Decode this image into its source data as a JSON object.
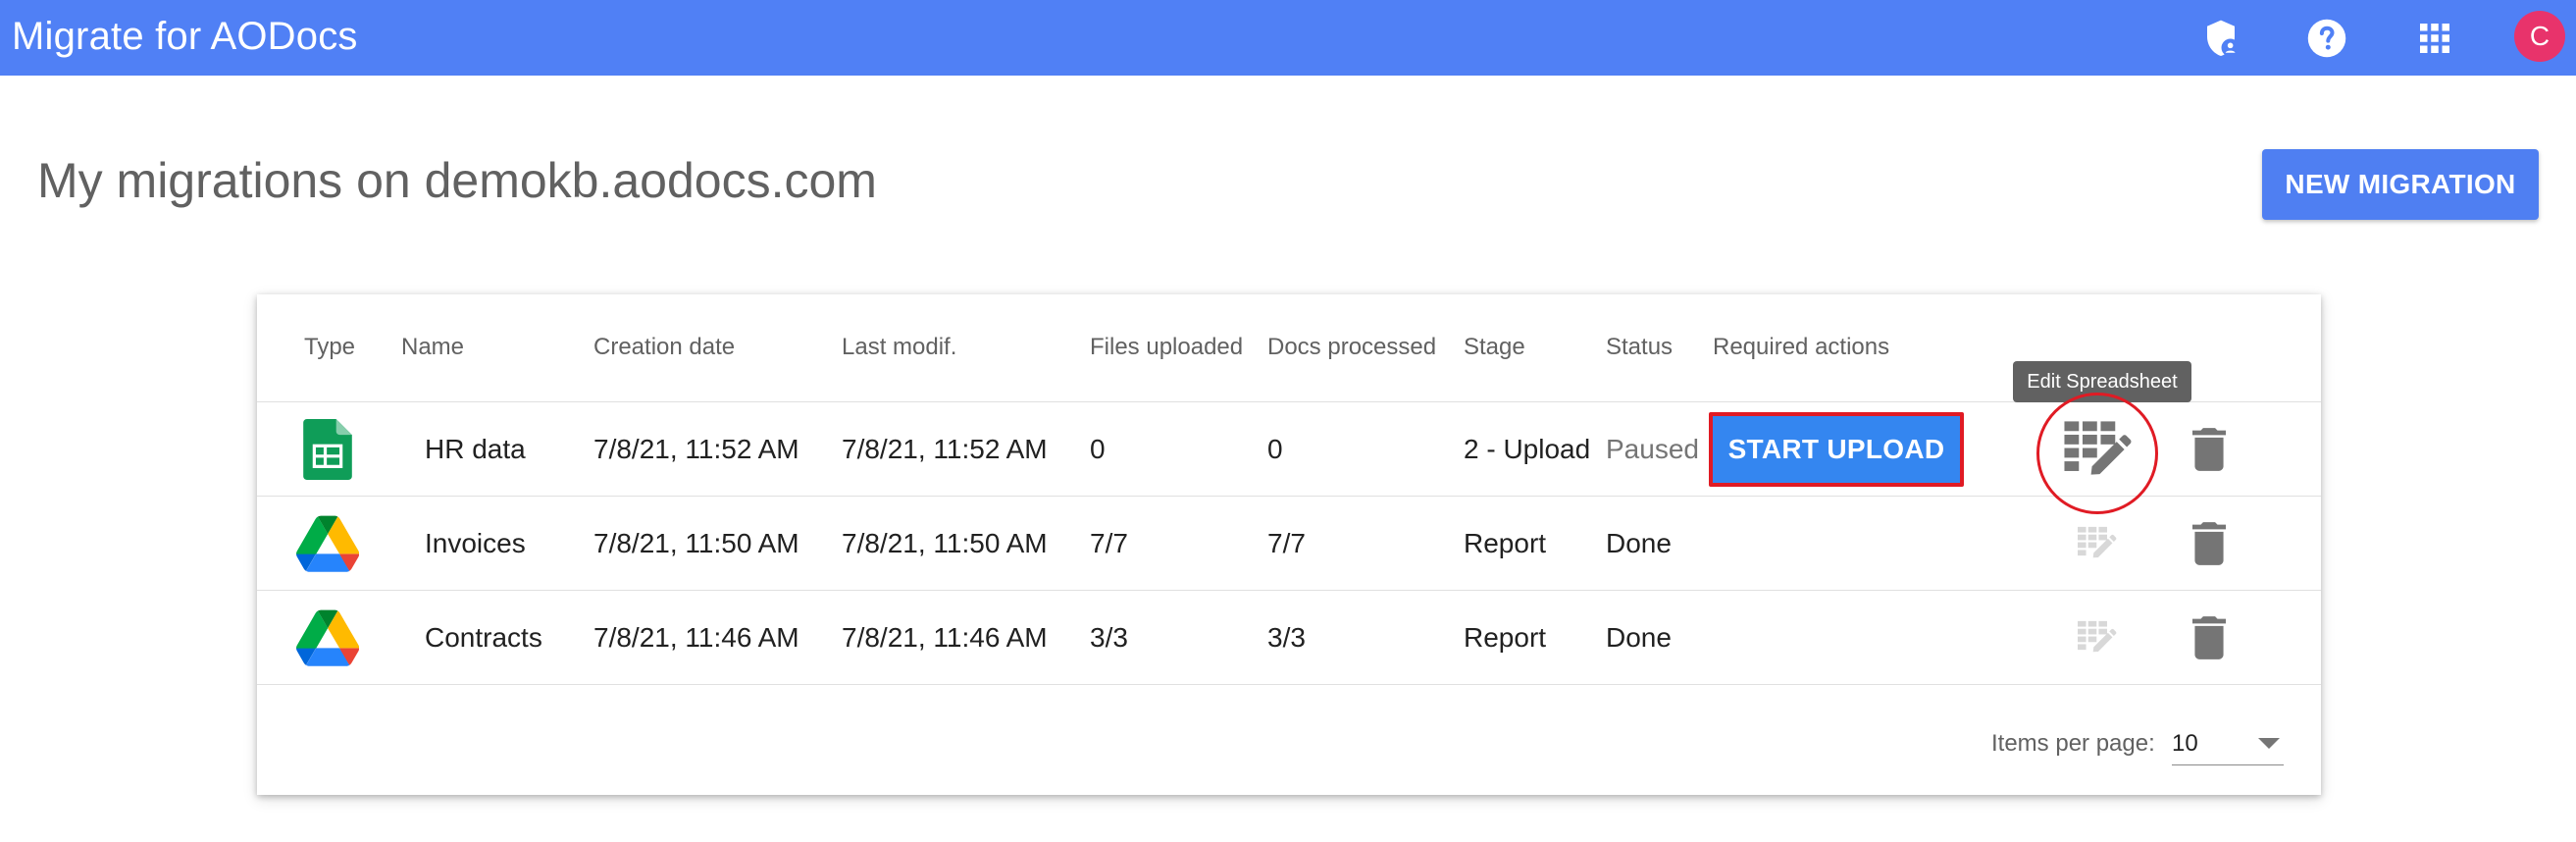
{
  "app": {
    "title": "Migrate for AODocs",
    "icons": [
      "admin-shield-icon",
      "help-icon",
      "apps-grid-icon"
    ],
    "avatar_letter": "C",
    "avatar_color": "#e8336b",
    "bar_color": "#5080f5"
  },
  "page": {
    "title": "My migrations on demokb.aodocs.com",
    "new_button": "NEW MIGRATION"
  },
  "table": {
    "columns": [
      "Type",
      "Name",
      "Creation date",
      "Last modif.",
      "Files uploaded",
      "Docs processed",
      "Stage",
      "Status",
      "Required actions"
    ],
    "rows": [
      {
        "type_icon": "google-sheets-icon",
        "name": "HR data",
        "created": "7/8/21, 11:52 AM",
        "modified": "7/8/21, 11:52 AM",
        "files": "0",
        "docs": "0",
        "stage": "2 - Upload",
        "status": "Paused",
        "action": "START UPLOAD"
      },
      {
        "type_icon": "google-drive-icon",
        "name": "Invoices",
        "created": "7/8/21, 11:50 AM",
        "modified": "7/8/21, 11:50 AM",
        "files": "7/7",
        "docs": "7/7",
        "stage": "Report",
        "status": "Done",
        "action": ""
      },
      {
        "type_icon": "google-drive-icon",
        "name": "Contracts",
        "created": "7/8/21, 11:46 AM",
        "modified": "7/8/21, 11:46 AM",
        "files": "3/3",
        "docs": "3/3",
        "stage": "Report",
        "status": "Done",
        "action": ""
      }
    ],
    "tooltip": "Edit Spreadsheet",
    "pager": {
      "label": "Items per page:",
      "value": "10"
    }
  },
  "colors": {
    "accent": "#4f7ff2",
    "start_button": "#3486f0",
    "highlight": "#e01b24"
  }
}
